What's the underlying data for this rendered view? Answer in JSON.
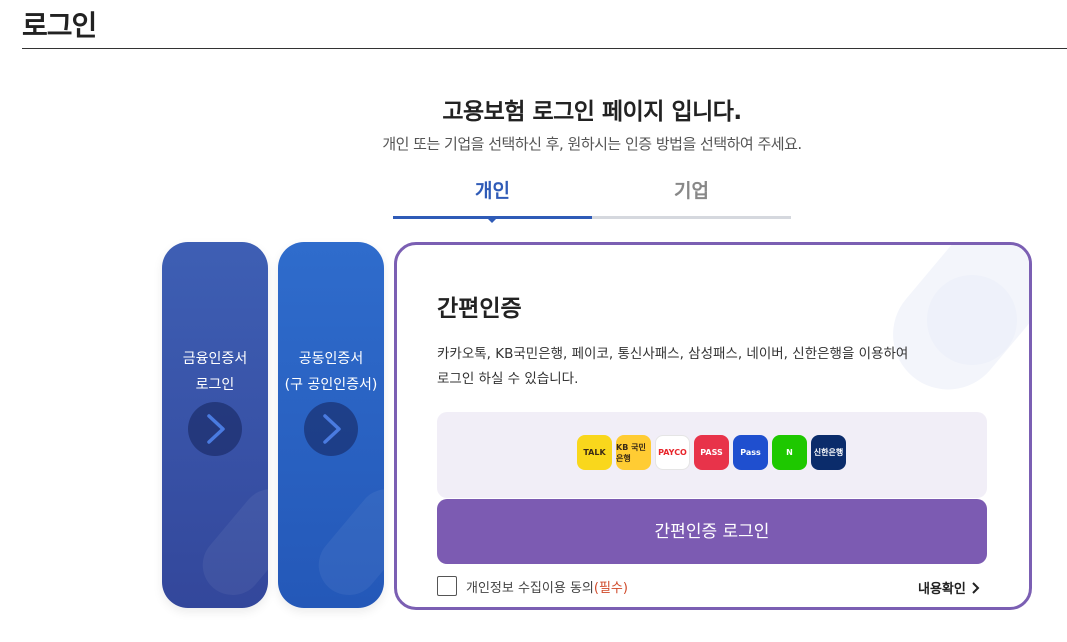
{
  "header": {
    "title": "로그인"
  },
  "intro": {
    "headline": "고용보험 로그인 페이지 입니다.",
    "subline": "개인 또는 기업을 선택하신 후, 원하시는 인증 방법을 선택하여 주세요."
  },
  "tabs": [
    {
      "label": "개인",
      "active": true
    },
    {
      "label": "기업",
      "active": false
    }
  ],
  "side_cards": [
    {
      "line1": "금융인증서",
      "line2": "로그인",
      "icon": "chevron-right-icon",
      "color": "#3a55a8"
    },
    {
      "line1": "공동인증서",
      "line2": "(구 공인인증서)",
      "icon": "chevron-right-icon",
      "color": "#2a63c4"
    }
  ],
  "simple_auth": {
    "title": "간편인증",
    "desc_line1": "카카오톡, KB국민은행, 페이코, 통신사패스, 삼성패스, 네이버, 신한은행을 이용하여",
    "desc_line2": "로그인 하실 수 있습니다.",
    "providers": [
      {
        "name": "kakaotalk-icon",
        "text": "TALK",
        "bg": "#f9d71c",
        "fg": "#3a2a16"
      },
      {
        "name": "kb-bank-icon",
        "text": "KB 국민은행",
        "bg": "#ffcc33",
        "fg": "#3a2a16"
      },
      {
        "name": "payco-icon",
        "text": "PAYCO",
        "bg": "#ffffff",
        "fg": "#e8252b"
      },
      {
        "name": "pass-icon",
        "text": "PASS",
        "bg": "#e8334a",
        "fg": "#ffffff"
      },
      {
        "name": "samsung-pass-icon",
        "text": "Pass",
        "bg": "#1f4fcf",
        "fg": "#ffffff"
      },
      {
        "name": "naver-icon",
        "text": "N",
        "bg": "#1ec800",
        "fg": "#ffffff"
      },
      {
        "name": "shinhan-bank-icon",
        "text": "신한은행",
        "bg": "#0b2c6b",
        "fg": "#ffffff"
      }
    ],
    "button_label": "간편인증 로그인",
    "agree_label": "개인정보 수집이용 동의",
    "agree_required": "(필수)",
    "detail_label": "내용확인"
  },
  "colors": {
    "accent_blue": "#2f5bb7",
    "accent_purple": "#7c5bb2",
    "required_red": "#d04a2a"
  }
}
